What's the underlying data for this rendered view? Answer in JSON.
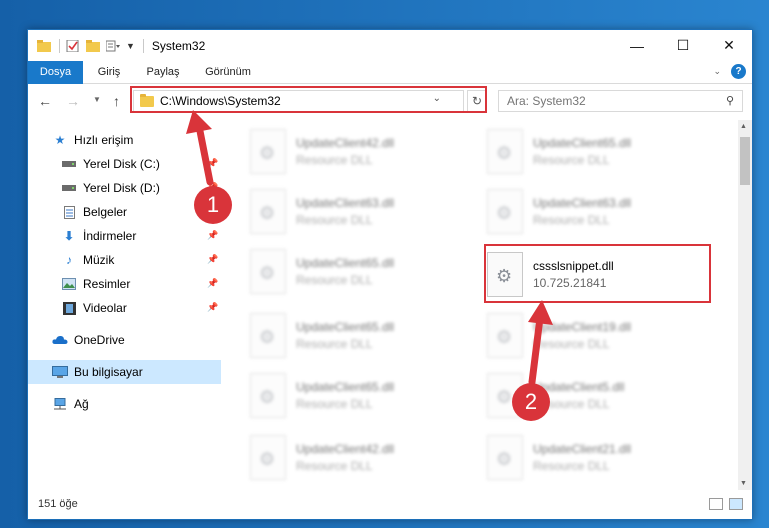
{
  "window": {
    "title": "System32",
    "controls": {
      "minimize": "—",
      "maximize": "☐",
      "close": "✕"
    }
  },
  "ribbon": {
    "tabs": [
      "Dosya",
      "Giriş",
      "Paylaş",
      "Görünüm"
    ],
    "collapse_icon": "chevron-down-icon",
    "help_label": "?"
  },
  "navigation": {
    "address_path": "C:\\Windows\\System32",
    "search_placeholder": "Ara: System32"
  },
  "sidebar": {
    "items": [
      {
        "label": "Hızlı erişim",
        "icon": "star-icon"
      },
      {
        "label": "Yerel Disk (C:)",
        "icon": "drive-icon"
      },
      {
        "label": "Yerel Disk (D:)",
        "icon": "drive-icon"
      },
      {
        "label": "Belgeler",
        "icon": "document-icon"
      },
      {
        "label": "İndirmeler",
        "icon": "download-icon"
      },
      {
        "label": "Müzik",
        "icon": "music-icon"
      },
      {
        "label": "Resimler",
        "icon": "pictures-icon"
      },
      {
        "label": "Videolar",
        "icon": "video-icon"
      },
      {
        "label": "OneDrive",
        "icon": "cloud-icon"
      },
      {
        "label": "Bu bilgisayar",
        "icon": "computer-icon"
      },
      {
        "label": "Ağ",
        "icon": "network-icon"
      }
    ]
  },
  "files": {
    "left_column": [
      {
        "name": "UpdateClient42.dll",
        "desc": "Resource DLL"
      },
      {
        "name": "UpdateClient63.dll",
        "desc": "Resource DLL"
      },
      {
        "name": "UpdateClient65.dll",
        "desc": "Resource DLL"
      },
      {
        "name": "UpdateClient65.dll",
        "desc": "Resource DLL"
      },
      {
        "name": "UpdateClient65.dll",
        "desc": "Resource DLL"
      },
      {
        "name": "UpdateClient42.dll",
        "desc": "Resource DLL"
      }
    ],
    "right_column": [
      {
        "name": "UpdateClient65.dll",
        "desc": "Resource DLL"
      },
      {
        "name": "UpdateClient63.dll",
        "desc": "Resource DLL"
      },
      {
        "name": "UpdateClient19.dll",
        "desc": "Resource DLL"
      },
      {
        "name": "UpdateClient5.dll",
        "desc": "Resource DLL"
      },
      {
        "name": "UpdateClient21.dll",
        "desc": "Resource DLL"
      }
    ],
    "highlighted": {
      "name": "cssslsnippet.dll",
      "desc": "10.725.21841"
    }
  },
  "status": {
    "item_count": "151 öğe"
  },
  "callouts": {
    "step1": "1",
    "step2": "2",
    "color": "#d9343a"
  }
}
